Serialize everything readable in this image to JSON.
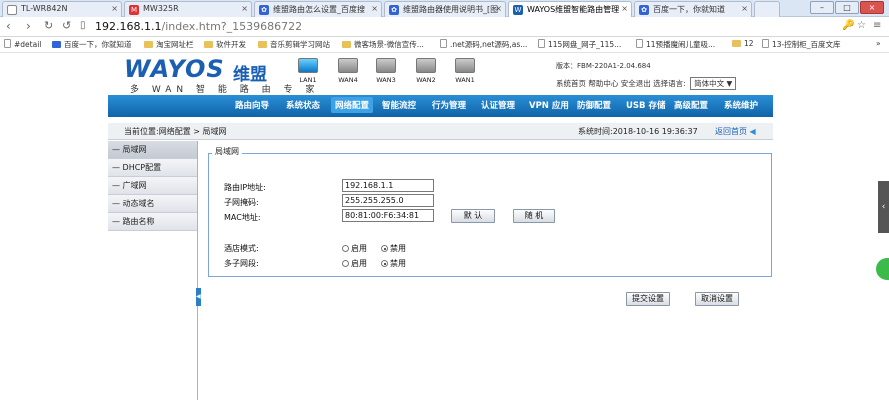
{
  "browser": {
    "tabs": [
      {
        "label": "TL-WR842N",
        "icon": "page-icon",
        "active": false
      },
      {
        "label": "MW325R",
        "icon": "mercury-icon",
        "active": false
      },
      {
        "label": "维盟路由怎么设置_百度搜",
        "icon": "baidu-paw-icon",
        "active": false
      },
      {
        "label": "维盟路由器使用说明书_[图",
        "icon": "baidu-paw-icon",
        "active": false
      },
      {
        "label": "WAYOS维盟智能路由管理",
        "icon": "wayos-w-icon",
        "active": true
      },
      {
        "label": "百度一下，你就知道",
        "icon": "baidu-paw-icon",
        "active": false
      }
    ],
    "url_host": "192.168.1.1",
    "url_path": "/index.htm?_1539686722",
    "bookmarks": [
      {
        "label": "#detail",
        "icon": "page-icon"
      },
      {
        "label": "百度一下，你就知道",
        "icon": "baidu-paw-icon"
      },
      {
        "label": "淘宝网址栏",
        "icon": "folder-icon"
      },
      {
        "label": "软件开发",
        "icon": "folder-icon"
      },
      {
        "label": "音乐剪辑学习网站",
        "icon": "folder-icon"
      },
      {
        "label": "微客场景-微信宣传...",
        "icon": "folder-icon"
      },
      {
        "label": ".net源码,net源码,as...",
        "icon": "page-icon"
      },
      {
        "label": "115网盘_网子_115...",
        "icon": "page-icon"
      },
      {
        "label": "11预播魔闹儿童吸...",
        "icon": "page-icon"
      },
      {
        "label": "12",
        "icon": "folder-icon"
      },
      {
        "label": "13-控制柜_百度文库",
        "icon": "page-icon"
      }
    ],
    "more_symbol": "»"
  },
  "router": {
    "logo_word": "WAYOS",
    "logo_cn": "维盟",
    "logo_sub": "多 WAN 智 能 路 由 专 家",
    "ports": [
      "LAN1",
      "WAN4",
      "WAN3",
      "WAN2",
      "WAN1"
    ],
    "version": "版本：FBM-220A1-2.04.684",
    "top_links": {
      "home": "系统首页",
      "help": "帮助中心",
      "logout": "安全退出",
      "lang_label": "选择语言:",
      "lang_value": "简体中文 ▼"
    },
    "menu": [
      "路由向导",
      "系统状态",
      "网络配置",
      "智能流控",
      "行为管理",
      "认证管理",
      "VPN 应用",
      "防御配置",
      "USB 存储",
      "高级配置",
      "系统维护"
    ],
    "active_menu": "网络配置",
    "breadcrumb": "当前位置:网络配置 > 局域网",
    "system_time": "系统时间:2018-10-16 19:36:37",
    "back_home": "返回首页",
    "sidebar": [
      "局域网",
      "DHCP配置",
      "广域网",
      "动态域名",
      "路由名称"
    ],
    "sidebar_prefix": "—",
    "legend": "局域网",
    "form": {
      "ip_label": "路由IP地址:",
      "ip_value": "192.168.1.1",
      "mask_label": "子网掩码:",
      "mask_value": "255.255.255.0",
      "mac_label": "MAC地址:",
      "mac_value": "80:81:00:F6:34:81",
      "default_btn": "默 认",
      "random_btn": "随 机",
      "hotel_label": "酒店模式:",
      "multi_label": "多子网段:",
      "enable": "启用",
      "disable": "禁用"
    },
    "submit_btn": "提交设置",
    "cancel_btn": "取消设置"
  }
}
